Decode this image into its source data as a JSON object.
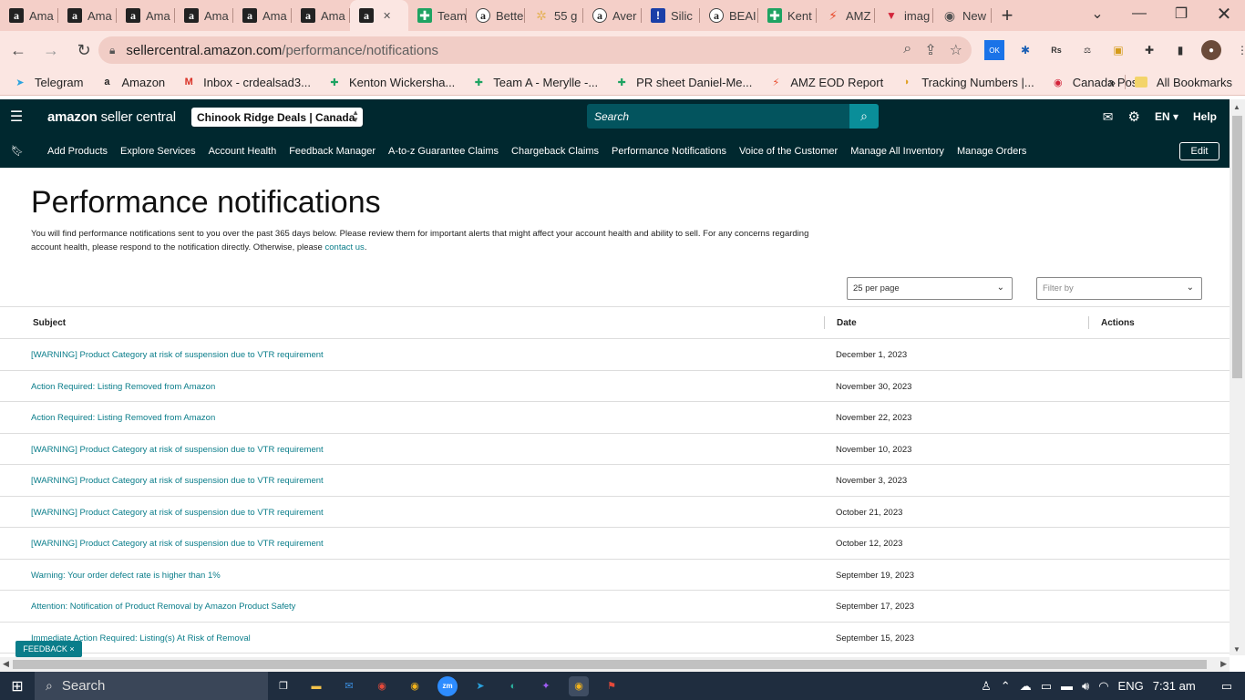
{
  "browser": {
    "tabs": [
      {
        "icon": "amazon-icon",
        "title": "Ama"
      },
      {
        "icon": "amazon-icon",
        "title": "Ama"
      },
      {
        "icon": "amazon-icon",
        "title": "Ama"
      },
      {
        "icon": "amazon-icon",
        "title": "Ama"
      },
      {
        "icon": "amazon-icon",
        "title": "Ama"
      },
      {
        "icon": "amazon-icon",
        "title": "Ama"
      },
      {
        "icon": "amazon-icon",
        "title": ""
      },
      {
        "icon": "sheets-icon",
        "title": "Team"
      },
      {
        "icon": "amazon-round-icon",
        "title": "Bette"
      },
      {
        "icon": "star-icon",
        "title": "55 g"
      },
      {
        "icon": "amazon-round-icon",
        "title": "Aver"
      },
      {
        "icon": "exclaim-icon",
        "title": "Silic"
      },
      {
        "icon": "amazon-round-icon",
        "title": "BEAI"
      },
      {
        "icon": "sheets-icon",
        "title": "Kent"
      },
      {
        "icon": "zap-icon",
        "title": "AMZ"
      },
      {
        "icon": "vivaldi-icon",
        "title": "imag"
      },
      {
        "icon": "globe-icon",
        "title": "New"
      }
    ],
    "url_host": "sellercentral.amazon.com",
    "url_path": "/performance/notifications",
    "bookmarks": [
      {
        "icon": "telegram-icon",
        "label": "Telegram",
        "color": "#2aa3df"
      },
      {
        "icon": "amazon-icon",
        "label": "Amazon",
        "color": "#222222"
      },
      {
        "icon": "gmail-icon",
        "label": "Inbox - crdealsad3...",
        "color": "#d93025"
      },
      {
        "icon": "sheets-icon",
        "label": "Kenton Wickersha...",
        "color": "#1ea362"
      },
      {
        "icon": "sheets-icon",
        "label": "Team A - Merylle -...",
        "color": "#1ea362"
      },
      {
        "icon": "sheets-icon",
        "label": "PR sheet Daniel-Me...",
        "color": "#1ea362"
      },
      {
        "icon": "zap-icon",
        "label": "AMZ EOD Report",
        "color": "#e84a2b"
      },
      {
        "icon": "taco-icon",
        "label": "Tracking Numbers |...",
        "color": "#e0a020"
      },
      {
        "icon": "canadapost-icon",
        "label": "Canada Post",
        "color": "#d3243a"
      }
    ],
    "bookmarks_more": "»",
    "all_bookmarks": "All Bookmarks"
  },
  "seller_central": {
    "logo_brand": "amazon",
    "logo_product": "seller central",
    "store": "Chinook Ridge Deals | Canada",
    "search_placeholder": "Search",
    "language": "EN",
    "help": "Help",
    "nav": [
      "Add Products",
      "Explore Services",
      "Account Health",
      "Feedback Manager",
      "A-to-z Guarantee Claims",
      "Chargeback Claims",
      "Performance Notifications",
      "Voice of the Customer",
      "Manage All Inventory",
      "Manage Orders"
    ],
    "edit": "Edit"
  },
  "page": {
    "title": "Performance notifications",
    "intro": "You will find performance notifications sent to you over the past 365 days below. Please review them for important alerts that might affect your account health and ability to sell. For any concerns regarding account health, please respond to the notification directly. Otherwise, please",
    "contact_link": "contact us",
    "intro_end": ".",
    "per_page": "25 per page",
    "filter_placeholder": "Filter by",
    "columns": {
      "subject": "Subject",
      "date": "Date",
      "actions": "Actions"
    },
    "rows": [
      {
        "subject": "[WARNING] Product Category at risk of suspension due to VTR requirement",
        "date": "December 1, 2023"
      },
      {
        "subject": "Action Required: Listing Removed from Amazon",
        "date": "November 30, 2023"
      },
      {
        "subject": "Action Required: Listing Removed from Amazon",
        "date": "November 22, 2023"
      },
      {
        "subject": "[WARNING] Product Category at risk of suspension due to VTR requirement",
        "date": "November 10, 2023"
      },
      {
        "subject": "[WARNING] Product Category at risk of suspension due to VTR requirement",
        "date": "November 3, 2023"
      },
      {
        "subject": "[WARNING] Product Category at risk of suspension due to VTR requirement",
        "date": "October 21, 2023"
      },
      {
        "subject": "[WARNING] Product Category at risk of suspension due to VTR requirement",
        "date": "October 12, 2023"
      },
      {
        "subject": "Warning: Your order defect rate is higher than 1%",
        "date": "September 19, 2023"
      },
      {
        "subject": "Attention: Notification of Product Removal by Amazon Product Safety",
        "date": "September 17, 2023"
      },
      {
        "subject": "Immediate Action Required: Listing(s) At Risk of Removal",
        "date": "September 15, 2023"
      }
    ],
    "feedback": "FEEDBACK ×"
  },
  "taskbar": {
    "search": "Search",
    "language": "ENG",
    "time": "7:31 am"
  },
  "colors": {
    "sc_header": "#00282f",
    "link": "#0a7d8a",
    "tabstrip": "#f4cfc8"
  }
}
